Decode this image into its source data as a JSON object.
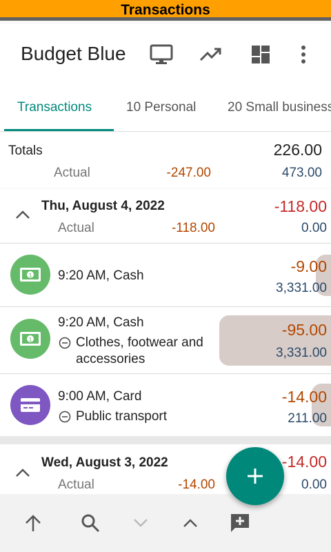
{
  "status_bar": {
    "title": "Transactions"
  },
  "app_bar": {
    "title": "Budget Blue"
  },
  "tabs": [
    {
      "label": "Transactions"
    },
    {
      "label": "10 Personal"
    },
    {
      "label": "20 Small business"
    }
  ],
  "totals": {
    "label": "Totals",
    "amount": "226.00",
    "actual_label": "Actual",
    "actual_amount": "-247.00",
    "balance": "473.00"
  },
  "day1": {
    "date": "Thu, August 4, 2022",
    "amount": "-118.00",
    "actual_label": "Actual",
    "actual_amount": "-118.00",
    "balance": "0.00"
  },
  "transactions": [
    {
      "time_account": "9:20 AM, Cash",
      "category": "",
      "amount": "-9.00",
      "balance": "3,331.00"
    },
    {
      "time_account": "9:20 AM, Cash",
      "category": "Clothes, footwear and accessories",
      "amount": "-95.00",
      "balance": "3,331.00"
    },
    {
      "time_account": "9:00 AM, Card",
      "category": "Public transport",
      "amount": "-14.00",
      "balance": "211.00"
    }
  ],
  "day2": {
    "date": "Wed, August 3, 2022",
    "amount": "-14.00",
    "actual_label": "Actual",
    "actual_amount": "-14.00",
    "balance": "0.00"
  },
  "colors": {
    "accent": "#00897b",
    "status": "#ffa000",
    "negative": "#b34700",
    "red": "#c62828"
  }
}
